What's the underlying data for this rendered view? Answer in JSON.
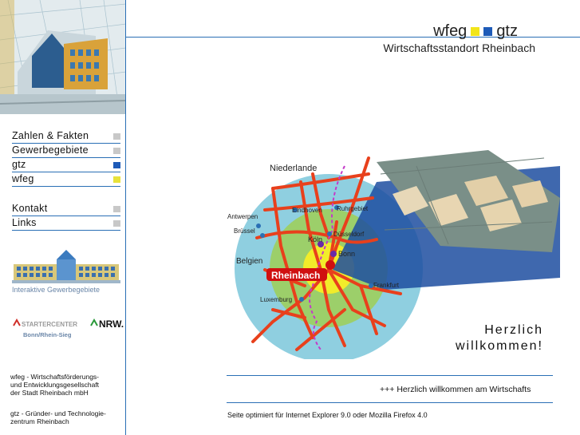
{
  "header": {
    "brand_left": "wfeg",
    "brand_right": "gtz",
    "subtitle": "Wirtschaftsstandort Rheinbach"
  },
  "nav": [
    {
      "label": "Zahlen & Fakten",
      "marker": "gray"
    },
    {
      "label": "Gewerbegebiete",
      "marker": "gray"
    },
    {
      "label": "gtz",
      "marker": "blue"
    },
    {
      "label": "wfeg",
      "marker": "yellow"
    },
    {
      "label": "Kontakt",
      "marker": "gray"
    },
    {
      "label": "Links",
      "marker": "gray"
    }
  ],
  "sidebar": {
    "gewerbe_label": "Interaktive Gewerbegebiete",
    "starter_center": "STARTERCENTER",
    "nrw": "NRW.",
    "starter_sub": "Bonn/Rhein-Sieg",
    "wfeg_desc": [
      "wfeg - Wirtschaftsförderungs-",
      "und Entwicklungsgesellschaft",
      "der Stadt Rheinbach mbH"
    ],
    "gtz_desc": [
      "gtz - Gründer- und Technologie-",
      "zentrum Rheinbach"
    ]
  },
  "map": {
    "labels": {
      "niederlande": "Niederlande",
      "eindhoven": "Eindhoven",
      "ruhrgebiet": "Ruhrgebiet",
      "antwerpen": "Antwerpen",
      "bruessel": "Brüssel",
      "koeln": "Köln",
      "duesseldorf": "Düsseldorf",
      "bonn": "Bonn",
      "belgien": "Belgien",
      "rheinbach": "Rheinbach",
      "frankfurt": "Frankfurt",
      "luxemburg": "Luxemburg"
    }
  },
  "welcome": {
    "line1": "Herzlich",
    "line2": "willkommen!"
  },
  "ticker": "+++ Herzlich willkommen am Wirtschafts",
  "optimized": "Seite optimiert für Internet Explorer 9.0 oder Mozilla Firefox 4.0",
  "colors": {
    "accent_blue": "#2a6fb5",
    "brand_yellow": "#f2e51a",
    "brand_blue": "#1e5bb8",
    "road_red": "#e8401c"
  }
}
